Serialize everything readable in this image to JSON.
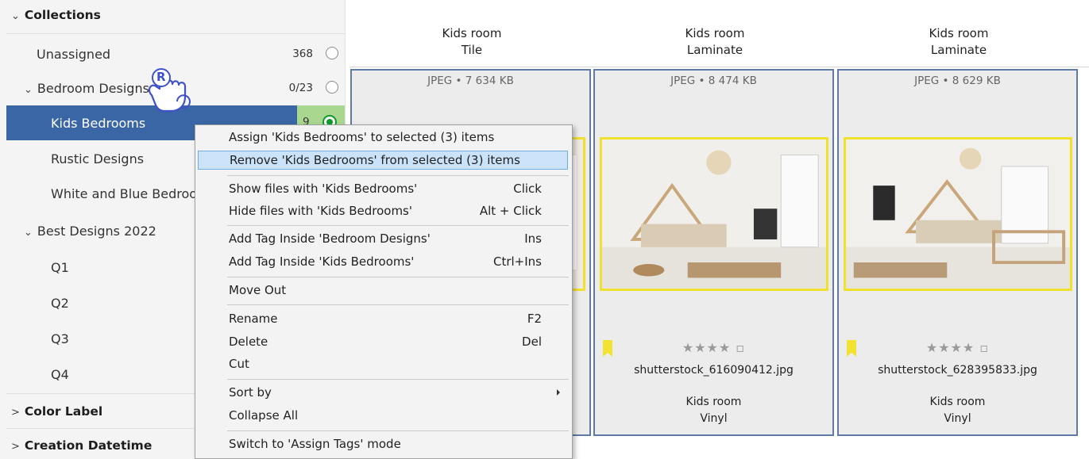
{
  "sidebar": {
    "collections_label": "Collections",
    "items": [
      {
        "label": "Unassigned",
        "count": "368"
      },
      {
        "label": "Bedroom Designs",
        "count": "0/23"
      },
      {
        "label": "Kids Bedrooms",
        "count": "9"
      },
      {
        "label": "Rustic Designs"
      },
      {
        "label": "White and Blue Bedroo"
      },
      {
        "label": "Best Designs 2022"
      },
      {
        "label": "Q1"
      },
      {
        "label": "Q2"
      },
      {
        "label": "Q3"
      },
      {
        "label": "Q4"
      }
    ],
    "color_label_section": "Color Label",
    "creation_datetime_section": "Creation Datetime"
  },
  "cursor_badge": "R",
  "columns": [
    {
      "title_line1": "Kids room",
      "title_line2": "Tile"
    },
    {
      "title_line1": "Kids room",
      "title_line2": "Laminate"
    },
    {
      "title_line1": "Kids room",
      "title_line2": "Laminate"
    }
  ],
  "cards": [
    {
      "meta": "JPEG • 7 634 KB"
    },
    {
      "meta": "JPEG • 8 474 KB",
      "stars": "★★★★ ▫",
      "filename": "shutterstock_616090412.jpg",
      "sub_line1": "Kids room",
      "sub_line2": "Vinyl"
    },
    {
      "meta": "JPEG • 8 629 KB",
      "stars": "★★★★ ▫",
      "filename": "shutterstock_628395833.jpg",
      "sub_line1": "Kids room",
      "sub_line2": "Vinyl"
    }
  ],
  "context_menu": {
    "items": [
      {
        "label": "Assign 'Kids Bedrooms' to selected (3) items"
      },
      {
        "label": "Remove 'Kids Bedrooms' from selected (3) items"
      },
      {
        "label": "Show files with 'Kids Bedrooms'",
        "shortcut": "Click"
      },
      {
        "label": "Hide files with 'Kids Bedrooms'",
        "shortcut": "Alt + Click"
      },
      {
        "label": "Add Tag Inside 'Bedroom Designs'",
        "shortcut": "Ins"
      },
      {
        "label": "Add Tag Inside 'Kids Bedrooms'",
        "shortcut": "Ctrl+Ins"
      },
      {
        "label": "Move Out"
      },
      {
        "label": "Rename",
        "shortcut": "F2"
      },
      {
        "label": "Delete",
        "shortcut": "Del"
      },
      {
        "label": "Cut"
      },
      {
        "label": "Sort by"
      },
      {
        "label": "Collapse All"
      },
      {
        "label": "Switch to 'Assign Tags' mode"
      }
    ]
  },
  "colors": {
    "selected_row": "#3a66a6",
    "assigned_green": "#a9d78f",
    "menu_highlight": "#cbe3f8",
    "card_border": "#5f7aa6",
    "photo_border": "#f0e030"
  }
}
